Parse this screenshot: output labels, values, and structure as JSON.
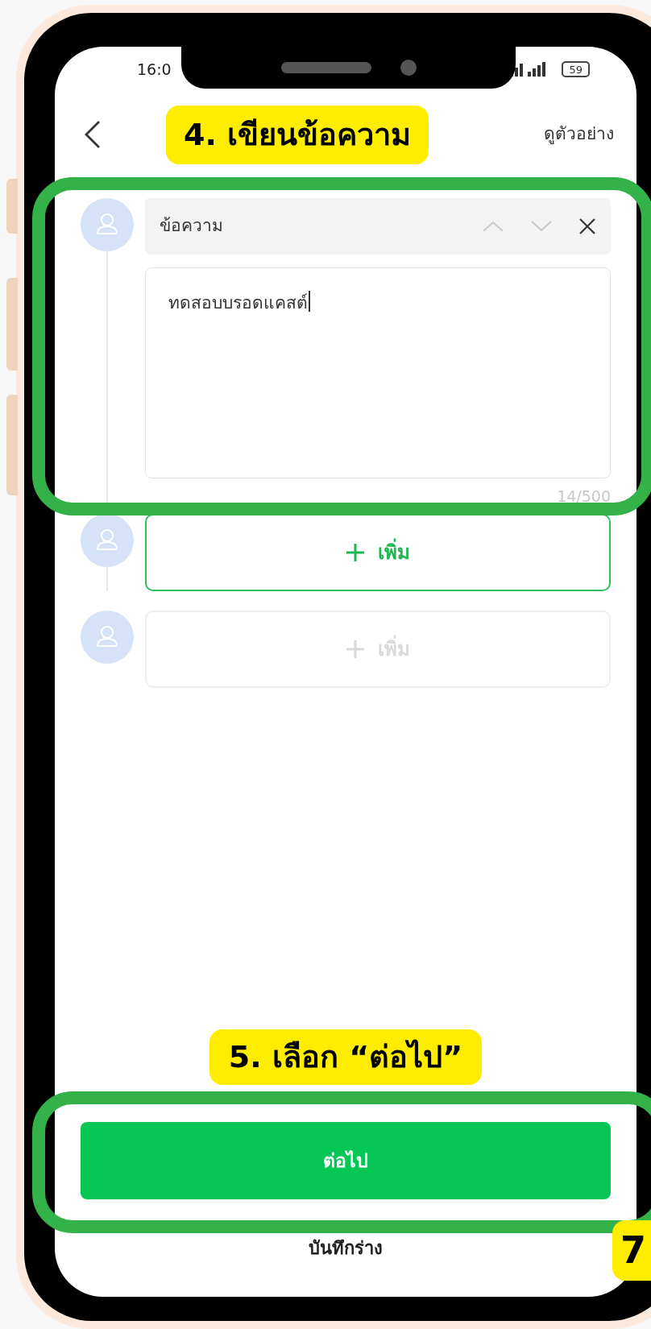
{
  "status_bar": {
    "time": "16:0",
    "battery": "59"
  },
  "header": {
    "step_label": "4. เขียนข้อความ",
    "preview_link": "ดูตัวอย่าง"
  },
  "messages": [
    {
      "kind": "text",
      "title": "ข้อความ",
      "value": "ทดสอบบรอดแคสต์",
      "counter": "14/500"
    },
    {
      "kind": "add",
      "label": "เพิ่ม",
      "disabled": false
    },
    {
      "kind": "add",
      "label": "เพิ่ม",
      "disabled": true
    }
  ],
  "footer": {
    "step_label": "5. เลือก “ต่อไป”",
    "next_button": "ต่อไป",
    "draft_link": "บันทึกร่าง",
    "page_badge": "7"
  }
}
